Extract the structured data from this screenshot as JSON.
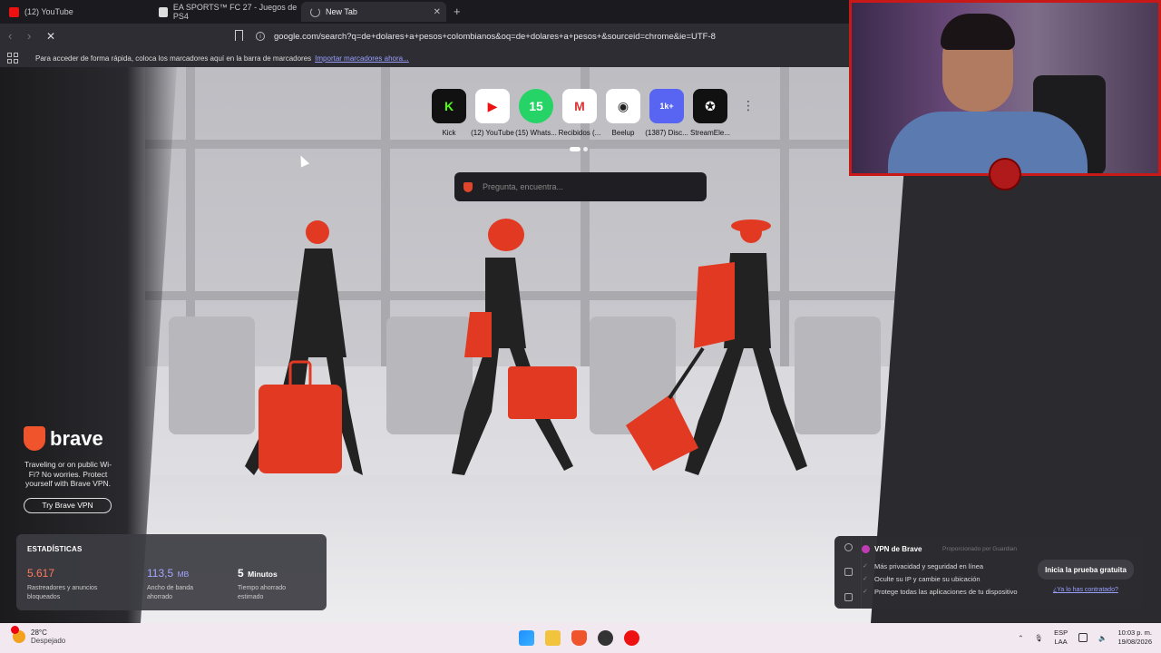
{
  "tabs": [
    {
      "label": "(12) YouTube",
      "icon": "youtube-icon",
      "color": "#e11"
    },
    {
      "label": "EA SPORTS™ FC 27 - Juegos de PS4",
      "icon": "ea-icon",
      "color": "#ddd"
    },
    {
      "label": "New Tab",
      "icon": "loading-icon",
      "color": "#aaa"
    }
  ],
  "toolbar": {
    "url": "google.com/search?q=de+dolares+a+pesos+colombianos&oq=de+dolares+a+pesos+&sourceid=chrome&ie=UTF-8"
  },
  "bookmarks_bar": {
    "message": "Para acceder de forma rápida, coloca los marcadores aquí en la barra de marcadores",
    "import_link": "Importar marcadores ahora..."
  },
  "top_sites": [
    {
      "label": "Kick",
      "glyph": "K",
      "bg": "#111",
      "fg": "#53fc18"
    },
    {
      "label": "(12) YouTube",
      "glyph": "▶",
      "bg": "#fff",
      "fg": "#e11"
    },
    {
      "label": "(15) Whats...",
      "glyph": "15",
      "bg": "#25d366",
      "fg": "#fff"
    },
    {
      "label": "Recibidos (...",
      "glyph": "M",
      "bg": "#fff",
      "fg": "#d33"
    },
    {
      "label": "Beelup",
      "glyph": "◉",
      "bg": "#fff",
      "fg": "#222"
    },
    {
      "label": "(1387) Disc...",
      "glyph": "1k+",
      "bg": "#5865f2",
      "fg": "#fff"
    },
    {
      "label": "StreamEle...",
      "glyph": "✪",
      "bg": "#111",
      "fg": "#fff"
    }
  ],
  "search": {
    "placeholder": "Pregunta, encuentra..."
  },
  "brave_promo": {
    "wordmark": "brave",
    "text": "Traveling or on public Wi-Fi? No worries. Protect yourself with Brave VPN.",
    "button": "Try Brave VPN"
  },
  "stats": {
    "title": "ESTADÍSTICAS",
    "items": [
      {
        "value": "5.617",
        "unit": "",
        "desc": "Rastreadores y anuncios bloqueados",
        "color": "#ff7a5c"
      },
      {
        "value": "113,5",
        "unit": "MB",
        "desc": "Ancho de banda ahorrado",
        "color": "#a3a7ff"
      },
      {
        "value": "5",
        "unit": "Minutos",
        "desc": "Tiempo ahorrado estimado",
        "color": "#ffffff"
      }
    ]
  },
  "vpn_panel": {
    "title": "VPN de Brave",
    "powered": "Proporcionado por Guardian",
    "items": [
      "Más privacidad y seguridad en línea",
      "Oculte su IP y cambie su ubicación",
      "Protege todas las aplicaciones de tu dispositivo"
    ],
    "cta": "Inicia la prueba gratuita",
    "have_link": "¿Ya lo has contratado?"
  },
  "taskbar": {
    "temp": "28°C",
    "weather": "Despejado",
    "lang1": "ESP",
    "lang2": "LAA",
    "time": "10:03 p. m.",
    "date": "19/08/2026"
  },
  "colors": {
    "accent": "#e23a22",
    "bg": "#2d2d33"
  }
}
